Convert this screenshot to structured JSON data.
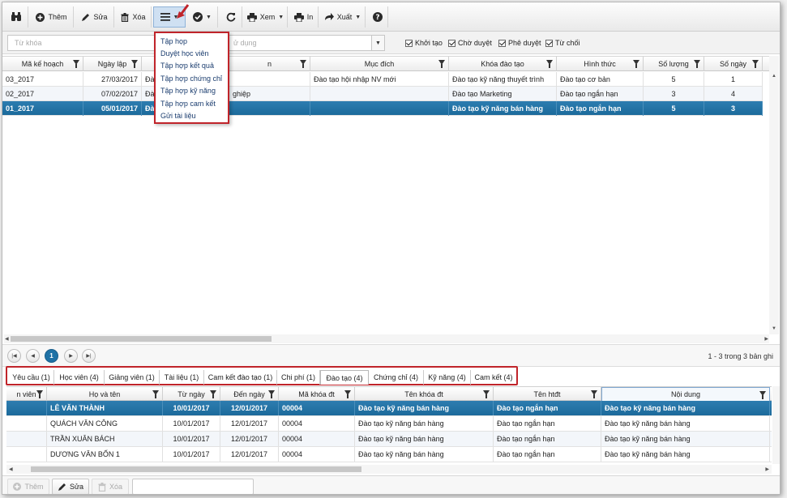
{
  "toolbar": {
    "buttons": [
      {
        "label": ""
      },
      {
        "label": "Thêm"
      },
      {
        "label": "Sửa"
      },
      {
        "label": "Xóa"
      },
      {
        "label": ""
      },
      {
        "label": ""
      },
      {
        "label": ""
      },
      {
        "label": "Xem"
      },
      {
        "label": "In"
      },
      {
        "label": "Xuất"
      },
      {
        "label": ""
      }
    ]
  },
  "menu": {
    "items": [
      "Tập họp",
      "Duyệt học viên",
      "Tập hợp kết quả",
      "Tập hợp chứng chỉ",
      "Tập hợp kỹ năng",
      "Tập hợp cam kết",
      "Gửi tài liệu"
    ]
  },
  "filter": {
    "keyword_placeholder": "Từ khóa",
    "user_placeholder": "ử dụng",
    "statuses": [
      "Khởi tạo",
      "Chờ duyệt",
      "Phê duyệt",
      "Từ chối"
    ]
  },
  "plan_grid": {
    "columns": [
      "Mã kế hoạch",
      "Ngày lập",
      "",
      "n",
      "Mục đích",
      "Khóa đào tạo",
      "Hình thức",
      "Số lượng",
      "Số ngày"
    ],
    "rows": [
      [
        "03_2017",
        "27/03/2017",
        "Đà",
        "",
        "Đào tạo hội nhập NV mới",
        "Đào tạo kỹ năng thuyết trình",
        "Đào tạo cơ bản",
        "5",
        "1"
      ],
      [
        "02_2017",
        "07/02/2017",
        "Đà",
        "ghiệp",
        "",
        "Đào tạo Marketing",
        "Đào tạo ngắn hạn",
        "3",
        "4"
      ],
      [
        "01_2017",
        "05/01/2017",
        "Đà",
        "",
        "",
        "Đào tạo kỹ năng bán hàng",
        "Đào tạo ngắn hạn",
        "5",
        "3"
      ]
    ]
  },
  "pager": {
    "current_page": "1",
    "info": "1 - 3 trong 3 bản ghi"
  },
  "detail_tabs": [
    "Yêu cầu (1)",
    "Học viên (4)",
    "Giảng viên (1)",
    "Tài liệu (1)",
    "Cam kết đào tạo (1)",
    "Chi phí (1)",
    "Đào tạo (4)",
    "Chứng chỉ (4)",
    "Kỹ năng (4)",
    "Cam kết (4)"
  ],
  "detail_grid": {
    "columns": [
      "n viên",
      "Họ và tên",
      "Từ ngày",
      "Đến ngày",
      "Mã khóa đt",
      "Tên khóa đt",
      "Tên htđt",
      "Nội dung"
    ],
    "rows": [
      [
        "",
        "LÊ VĂN THÀNH",
        "10/01/2017",
        "12/01/2017",
        "00004",
        "Đào tạo kỹ năng bán hàng",
        "Đào tạo ngắn hạn",
        "Đào tạo kỹ năng bán hàng"
      ],
      [
        "",
        "QUÁCH VĂN CÔNG",
        "10/01/2017",
        "12/01/2017",
        "00004",
        "Đào tạo kỹ năng bán hàng",
        "Đào tạo ngắn hạn",
        "Đào tạo kỹ năng bán hàng"
      ],
      [
        "",
        "TRẦN XUÂN BÁCH",
        "10/01/2017",
        "12/01/2017",
        "00004",
        "Đào tạo kỹ năng bán hàng",
        "Đào tạo ngắn hạn",
        "Đào tạo kỹ năng bán hàng"
      ],
      [
        "",
        "DƯƠNG VĂN BỐN 1",
        "10/01/2017",
        "12/01/2017",
        "00004",
        "Đào tạo kỹ năng bán hàng",
        "Đào tạo ngắn hạn",
        "Đào tạo kỹ năng bán hàng"
      ]
    ]
  },
  "bottom": {
    "add_label": "Thêm",
    "edit_label": "Sửa",
    "delete_label": "Xóa"
  },
  "colors": {
    "selected_row": "#1f72a6",
    "highlight_border": "#c0242a"
  }
}
